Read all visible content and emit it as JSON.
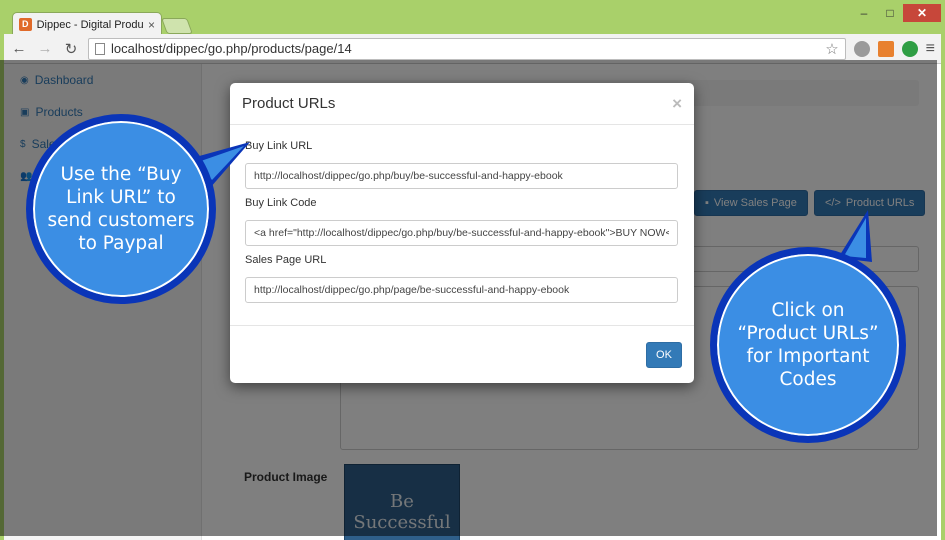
{
  "browser": {
    "tab_title": "Dippec - Digital Product M",
    "url": "localhost/dippec/go.php/products/page/14"
  },
  "sidebar": {
    "items": [
      {
        "icon": "dashboard-icon",
        "label": "Dashboard"
      },
      {
        "icon": "products-icon",
        "label": "Products"
      },
      {
        "icon": "dollar-icon",
        "label": "Sales"
      },
      {
        "icon": "users-icon",
        "label": ""
      }
    ]
  },
  "main": {
    "view_sales_button": "View Sales Page",
    "product_urls_button": "Product URLs",
    "product_image_label": "Product Image",
    "cover_text": "Be Successful"
  },
  "modal": {
    "title": "Product URLs",
    "close": "×",
    "fields": [
      {
        "label": "Buy Link URL",
        "value": "http://localhost/dippec/go.php/buy/be-successful-and-happy-ebook"
      },
      {
        "label": "Buy Link Code",
        "value": "<a href=\"http://localhost/dippec/go.php/buy/be-successful-and-happy-ebook\">BUY NOW</a>"
      },
      {
        "label": "Sales Page URL",
        "value": "http://localhost/dippec/go.php/page/be-successful-and-happy-ebook"
      }
    ],
    "ok_label": "OK"
  },
  "callouts": {
    "left": "Use the “Buy\nLink URL” to\nsend customers\nto Paypal",
    "right": "Click on\n“Product URLs”\nfor Important\nCodes"
  },
  "colors": {
    "window_frame": "#a9d06a",
    "primary_button": "#337ab7",
    "callout_fill": "#3b8ee4",
    "callout_border": "#0a35b8"
  }
}
